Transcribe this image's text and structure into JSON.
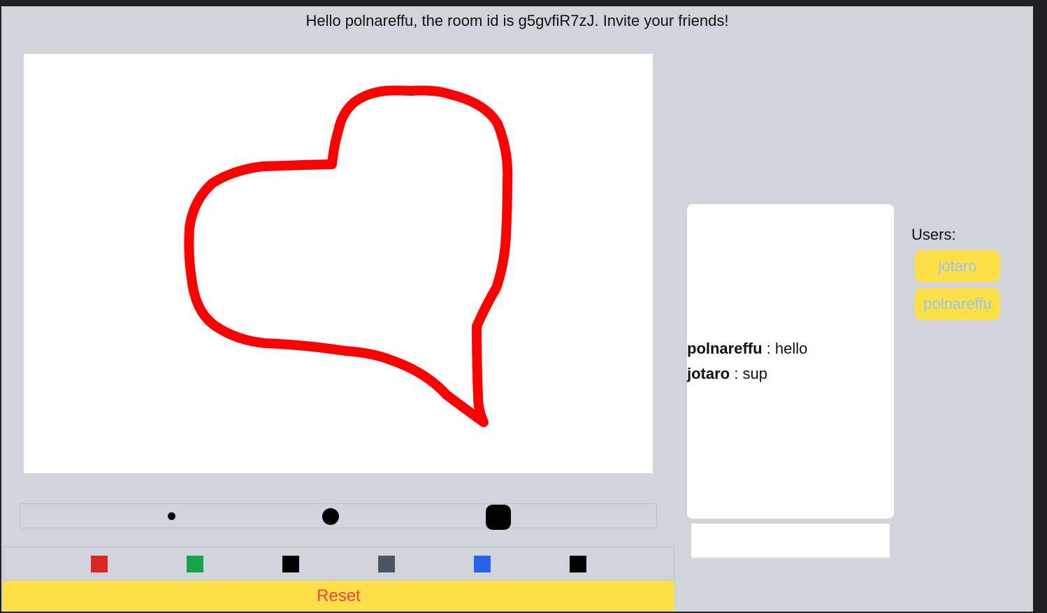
{
  "header": {
    "greeting": "Hello polnareffu, the room id is g5gvfiR7zJ. Invite your friends!"
  },
  "canvas": {
    "stroke_color": "#ff0000",
    "background": "#ffffff"
  },
  "brush_sizes": [
    {
      "name": "small",
      "shape": "circle"
    },
    {
      "name": "medium",
      "shape": "circle"
    },
    {
      "name": "large",
      "shape": "rounded-square"
    }
  ],
  "colors": [
    "#dc2626",
    "#16a34a",
    "#000000",
    "#4b5563",
    "#2563eb",
    "#000000"
  ],
  "reset_label": "Reset",
  "chat": {
    "messages": [
      {
        "user": "polnareffu",
        "text": "hello"
      },
      {
        "user": "jotaro",
        "text": "sup"
      }
    ],
    "separator": " : ",
    "input_value": ""
  },
  "users": {
    "label": "Users:",
    "list": [
      "jotaro",
      "polnareffu"
    ]
  }
}
